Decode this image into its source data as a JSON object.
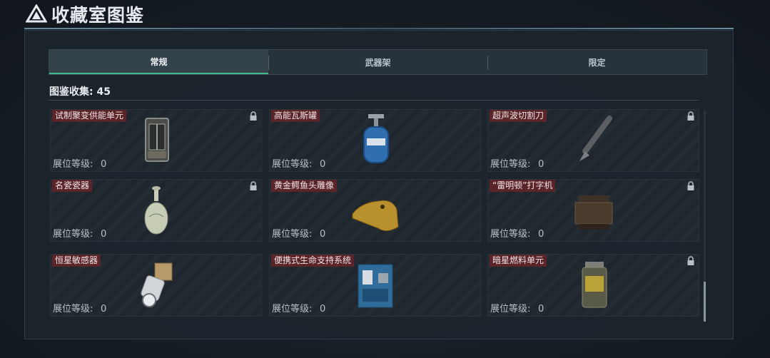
{
  "header": {
    "title": "收藏室图鉴"
  },
  "tabs": [
    {
      "label": "常规",
      "active": true
    },
    {
      "label": "武器架",
      "active": false
    },
    {
      "label": "限定",
      "active": false
    }
  ],
  "collection": {
    "label": "图鉴收集:",
    "count": "45"
  },
  "level_label": "展位等级:",
  "items": [
    {
      "name": "试制聚变供能单元",
      "level": "0",
      "locked": true,
      "icon": "fusion-unit-icon"
    },
    {
      "name": "高能瓦斯罐",
      "level": "0",
      "locked": false,
      "icon": "gas-canister-icon"
    },
    {
      "name": "超声波切割刀",
      "level": "0",
      "locked": true,
      "icon": "ultrasonic-knife-icon"
    },
    {
      "name": "名瓷瓷器",
      "level": "0",
      "locked": true,
      "icon": "porcelain-vase-icon"
    },
    {
      "name": "黄金鳄鱼头雕像",
      "level": "0",
      "locked": false,
      "icon": "gold-crocodile-icon"
    },
    {
      "name": "“雷明顿”打字机",
      "level": "0",
      "locked": true,
      "icon": "typewriter-icon"
    },
    {
      "name": "恒星敏感器",
      "level": "0",
      "locked": false,
      "icon": "star-sensor-icon"
    },
    {
      "name": "便携式生命支持系统",
      "level": "0",
      "locked": false,
      "icon": "life-support-icon"
    },
    {
      "name": "暗星燃料单元",
      "level": "0",
      "locked": true,
      "icon": "fuel-cell-icon"
    }
  ],
  "colors": {
    "accent": "#3fb88f",
    "name_tag": "#5a2428"
  }
}
